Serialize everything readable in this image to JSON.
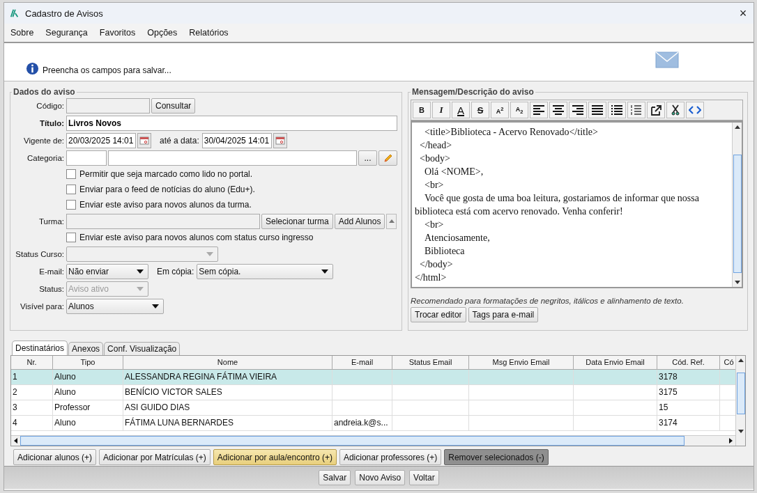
{
  "window": {
    "title": "Cadastro de Avisos",
    "close": "×"
  },
  "menu": [
    {
      "label": "Sobre"
    },
    {
      "label": "Segurança"
    },
    {
      "label": "Favoritos"
    },
    {
      "label": "Opções"
    },
    {
      "label": "Relatórios"
    }
  ],
  "info": {
    "message": "Preencha os campos para salvar..."
  },
  "dados": {
    "title": "Dados do aviso",
    "codigo": {
      "label": "Código:",
      "button": "Consultar"
    },
    "titulo": {
      "label": "Título:",
      "value": "Livros Novos"
    },
    "vigente": {
      "label": "Vigente de:",
      "value": "20/03/2025 14:01",
      "to_label": "até a data:",
      "to_value": "30/04/2025 14:01"
    },
    "categoria": {
      "label": "Categoria:",
      "button": "..."
    },
    "checks_top": [
      {
        "label": "Permitir que seja marcado como lido no portal.",
        "checked": false
      },
      {
        "label": "Enviar para o feed de notícias do aluno (Edu+).",
        "checked": false
      },
      {
        "label": "Enviar este aviso para novos alunos da turma.",
        "checked": false
      }
    ],
    "turma": {
      "label": "Turma:",
      "buttons": [
        "Selecionar turma",
        "Add Alunos"
      ]
    },
    "check_ingresso": {
      "label": "Enviar este aviso para novos alunos com status curso ingresso",
      "checked": false
    },
    "status_curso": {
      "label": "Status Curso:",
      "disabled": true
    },
    "email": {
      "label": "E-mail:",
      "value": "Não enviar",
      "disabled": false
    },
    "copia": {
      "label": "Em cópia:",
      "value": "Sem cópia.",
      "disabled": false
    },
    "status": {
      "label": "Status:",
      "value": "Aviso ativo",
      "disabled": true
    },
    "visivel": {
      "label": "Visível para:",
      "value": "Alunos",
      "disabled": false
    }
  },
  "mensagem": {
    "title": "Mensagem/Descrição do aviso",
    "toolbar": [
      {
        "kind": "bold",
        "glyph": "B"
      },
      {
        "kind": "italic",
        "glyph": "I"
      },
      {
        "kind": "color",
        "glyph": "A"
      },
      {
        "kind": "strike",
        "glyph": "S"
      },
      {
        "kind": "sup",
        "glyph": "A$^{2}$"
      },
      {
        "kind": "sub",
        "glyph": "A$_{2}$"
      },
      {
        "kind": "left"
      },
      {
        "kind": "center"
      },
      {
        "kind": "right"
      },
      {
        "kind": "justify"
      },
      {
        "kind": "bullets"
      },
      {
        "kind": "numbers"
      },
      {
        "kind": "link"
      },
      {
        "kind": "cut"
      },
      {
        "kind": "code"
      }
    ],
    "content": "    <title>Biblioteca - Acervo Renovado</title>\n  </head>\n  <body>\n    Olá <NOME>,\n    <br>\n    Você que gosta de uma boa leitura, gostariamos de informar que nossa biblioteca está com acervo renovado. Venha conferir!\n    <br>\n    Atenciosamente,\n    Biblioteca\n  </body>\n</html>",
    "hint": "Recomendado para formatações de negritos, itálicos e alinhamento de texto.",
    "buttons": [
      "Trocar editor",
      "Tags para e-mail"
    ]
  },
  "tabs": [
    {
      "label": "Destinatários",
      "selected": true
    },
    {
      "label": "Anexos",
      "selected": false
    },
    {
      "label": "Conf. Visualização",
      "selected": false
    }
  ],
  "table": {
    "columns": [
      "Nr.",
      "Tipo",
      "Nome",
      "E-mail",
      "Status Email",
      "Msg Envio Email",
      "Data Envio Email",
      "Cód. Ref.",
      "Có"
    ],
    "rows": [
      {
        "selected": true,
        "cells": [
          "1",
          "Aluno",
          "ALESSANDRA REGINA FÁTIMA VIEIRA",
          "",
          "",
          "",
          "",
          "3178",
          ""
        ]
      },
      {
        "selected": false,
        "cells": [
          "2",
          "Aluno",
          "BENÍCIO VICTOR SALES",
          "",
          "",
          "",
          "",
          "3175",
          ""
        ]
      },
      {
        "selected": false,
        "cells": [
          "3",
          "Professor",
          "ASI GUIDO DIAS",
          "",
          "",
          "",
          "",
          "15",
          ""
        ]
      },
      {
        "selected": false,
        "cells": [
          "4",
          "Aluno",
          "FÁTIMA LUNA BERNARDES",
          "andreia.k@s...",
          "",
          "",
          "",
          "3174",
          ""
        ]
      }
    ]
  },
  "actions": [
    {
      "label": "Adicionar alunos (+)",
      "kind": "normal"
    },
    {
      "label": "Adicionar por Matrículas (+)",
      "kind": "normal"
    },
    {
      "label": "Adicionar por aula/encontro (+)",
      "kind": "highlight"
    },
    {
      "label": "Adicionar professores (+)",
      "kind": "normal"
    },
    {
      "label": "Remover selecionados (-)",
      "kind": "dark"
    }
  ],
  "footer": [
    "Salvar",
    "Novo Aviso",
    "Voltar"
  ]
}
